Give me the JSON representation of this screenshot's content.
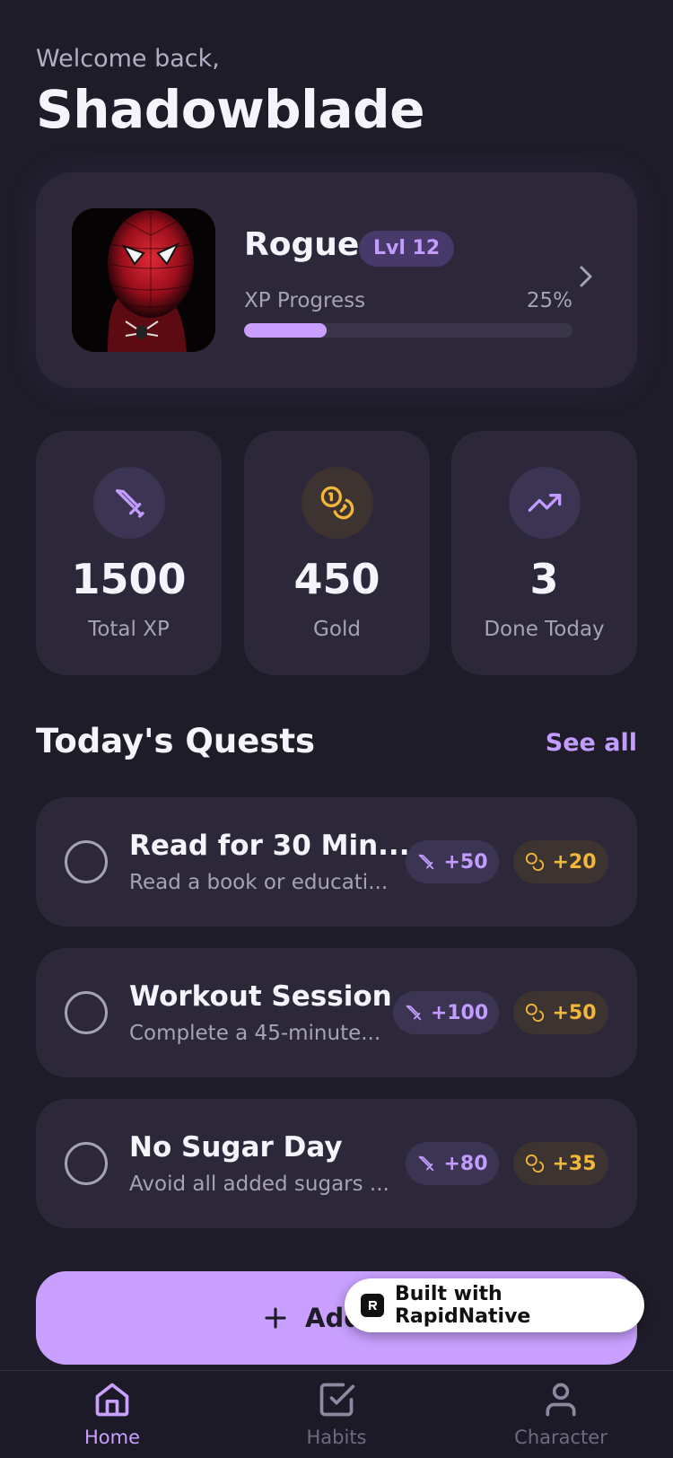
{
  "header": {
    "welcome": "Welcome back,",
    "username": "Shadowblade"
  },
  "profile": {
    "class_name": "Rogue",
    "level_badge": "Lvl 12",
    "xp_label": "XP Progress",
    "xp_percent_text": "25%",
    "xp_progress": 0.25,
    "avatar_icon": "spider-hero-avatar"
  },
  "stats": [
    {
      "value": "1500",
      "label": "Total XP",
      "icon": "sword-icon"
    },
    {
      "value": "450",
      "label": "Gold",
      "icon": "coins-icon"
    },
    {
      "value": "3",
      "label": "Done Today",
      "icon": "trending-up-icon"
    }
  ],
  "quests": {
    "title": "Today's Quests",
    "see_all": "See all",
    "items": [
      {
        "title": "Read for 30 Min...",
        "desc": "Read a book or educati...",
        "xp": "+50",
        "gold": "+20"
      },
      {
        "title": "Workout Session",
        "desc": "Complete a 45-minute...",
        "xp": "+100",
        "gold": "+50"
      },
      {
        "title": "No Sugar Day",
        "desc": "Avoid all added sugars ...",
        "xp": "+80",
        "gold": "+35"
      }
    ]
  },
  "add_button": {
    "label": "Add Ne"
  },
  "built_badge": {
    "label": "Built with RapidNative"
  },
  "nav": {
    "items": [
      {
        "label": "Home",
        "icon": "home-icon",
        "active": true
      },
      {
        "label": "Habits",
        "icon": "checkbox-icon",
        "active": false
      },
      {
        "label": "Character",
        "icon": "user-icon",
        "active": false
      }
    ]
  },
  "colors": {
    "background": "#1f1c29",
    "card": "#2c2839",
    "accent": "#c9a0ff",
    "accent_text": "#c29cff",
    "gold": "#f2b73a",
    "muted": "#a7a2b8"
  }
}
